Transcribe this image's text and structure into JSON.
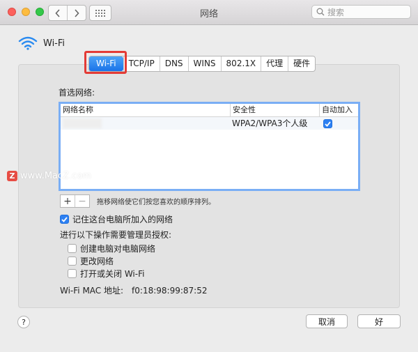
{
  "window": {
    "title": "网络",
    "search_placeholder": "搜索"
  },
  "header": {
    "label": "Wi-Fi"
  },
  "tabs": [
    {
      "label": "Wi-Fi",
      "active": true
    },
    {
      "label": "TCP/IP",
      "active": false
    },
    {
      "label": "DNS",
      "active": false
    },
    {
      "label": "WINS",
      "active": false
    },
    {
      "label": "802.1X",
      "active": false
    },
    {
      "label": "代理",
      "active": false
    },
    {
      "label": "硬件",
      "active": false
    }
  ],
  "preferred": {
    "label": "首选网络:",
    "columns": [
      "网络名称",
      "安全性",
      "自动加入"
    ],
    "rows": [
      {
        "name": "",
        "security": "WPA2/WPA3个人级",
        "auto_join": true
      }
    ],
    "add_label": "+",
    "remove_label": "−",
    "drag_hint": "拖移网络使它们按您喜欢的顺序排列。"
  },
  "watermark": {
    "badge": "Z",
    "text": "www.MacZ.com"
  },
  "remember": {
    "label": "记住这台电脑所加入的网络",
    "checked": true
  },
  "admin": {
    "label": "进行以下操作需要管理员授权:",
    "options": [
      {
        "label": "创建电脑对电脑网络",
        "checked": false
      },
      {
        "label": "更改网络",
        "checked": false
      },
      {
        "label": "打开或关闭 Wi-Fi",
        "checked": false
      }
    ]
  },
  "mac": {
    "label": "Wi-Fi MAC 地址:",
    "value": "f0:18:98:99:87:52"
  },
  "footer": {
    "help": "?",
    "cancel": "取消",
    "ok": "好"
  },
  "colors": {
    "accent": "#1a73e8",
    "highlight": "#e33b36",
    "table_border": "#7aaef5"
  }
}
